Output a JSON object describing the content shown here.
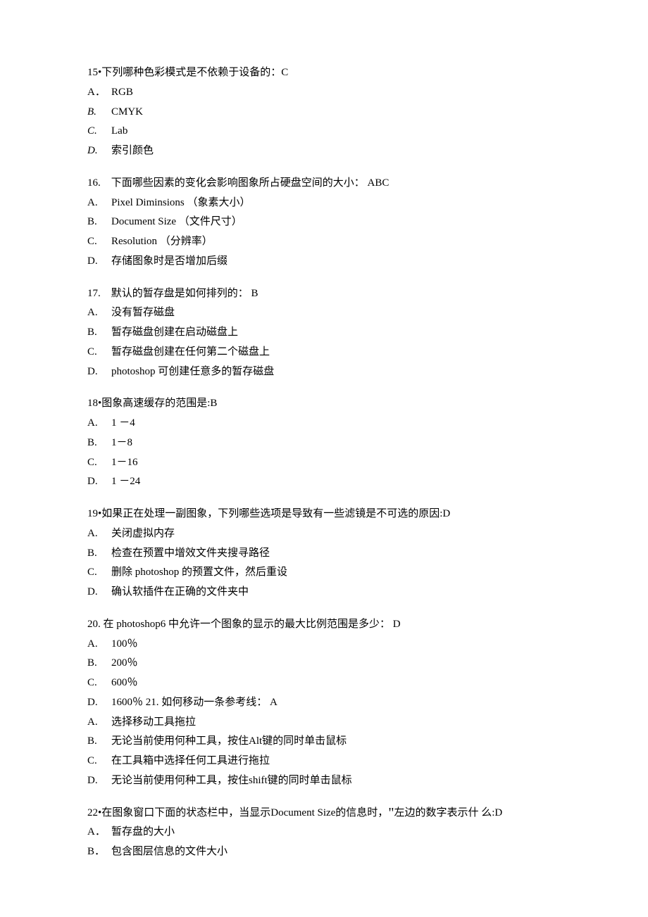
{
  "q15": {
    "stem": "15•下列哪种色彩模式是不依赖于设备的：C",
    "opts": [
      {
        "l": "A．",
        "t": "RGB",
        "italic": false
      },
      {
        "l": "B.",
        "t": "CMYK",
        "italic": true
      },
      {
        "l": "C.",
        "t": "Lab",
        "italic": true
      },
      {
        "l": "D.",
        "t": "索引颜色",
        "italic": true
      }
    ]
  },
  "q16": {
    "stem": "16.　下面哪些因素的变化会影响图象所占硬盘空间的大小：   ABC",
    "opts": [
      {
        "l": "A.",
        "t": "Pixel Diminsions （象素大小）"
      },
      {
        "l": "B.",
        "t": "Document Size （文件尺寸）"
      },
      {
        "l": "C.",
        "t": "Resolution （分辨率）"
      },
      {
        "l": "D.",
        "t": "存储图象时是否增加后缀"
      }
    ]
  },
  "q17": {
    "stem": "17.　默认的暂存盘是如何排列的：   B",
    "opts": [
      {
        "l": "A.",
        "t": "没有暂存磁盘"
      },
      {
        "l": "B.",
        "t": "暂存磁盘创建在启动磁盘上"
      },
      {
        "l": "C.",
        "t": "暂存磁盘创建在任何第二个磁盘上"
      },
      {
        "l": "D.",
        "t": "photoshop 可创建任意多的暂存磁盘"
      }
    ]
  },
  "q18": {
    "stem": "18•图象高速缓存的范围是:B",
    "opts": [
      {
        "l": "A.",
        "t": "1 －4"
      },
      {
        "l": "B.",
        "t": "1－8"
      },
      {
        "l": "C.",
        "t": "1－16"
      },
      {
        "l": "D.",
        "t": "1 －24"
      }
    ]
  },
  "q19": {
    "stem": "19•如果正在处理一副图象，下列哪些选项是导致有一些滤镜是不可选的原因:D",
    "opts": [
      {
        "l": "A.",
        "t": "关闭虚拟内存"
      },
      {
        "l": "B.",
        "t": "检查在预置中增效文件夹搜寻路径"
      },
      {
        "l": "C.",
        "t": "删除  photoshop 的预置文件，然后重设"
      },
      {
        "l": "D.",
        "t": "确认软插件在正确的文件夹中"
      }
    ]
  },
  "q20": {
    "stem": "20. 在  photoshop6 中允许一个图象的显示的最大比例范围是多少：   D",
    "opts": [
      {
        "l": "A.",
        "t": "100％"
      },
      {
        "l": "B.",
        "t": "200％"
      },
      {
        "l": "C.",
        "t": "600％"
      }
    ],
    "dline": {
      "l": "D.",
      "t": "1600％  21. 如何移动一条参考线：   A"
    },
    "opts21": [
      {
        "l": "A.",
        "t": "选择移动工具拖拉"
      },
      {
        "l": "B.",
        "t": "无论当前使用何种工具，按住Alt键的同时单击鼠标"
      },
      {
        "l": "C.",
        "t": "在工具箱中选择任何工具进行拖拉"
      },
      {
        "l": "D.",
        "t": "无论当前使用何种工具，按住shift键的同时单击鼠标"
      }
    ]
  },
  "q22": {
    "stem_pre": "22•在图象窗口下面的状态栏中，当显示Document Size的信息时，",
    "quote": "\"",
    "stem_post": "左边的数字表示什  么:D",
    "opts": [
      {
        "l": "A．",
        "t": "暂存盘的大小"
      },
      {
        "l": "B．",
        "t": "包含图层信息的文件大小"
      }
    ]
  }
}
